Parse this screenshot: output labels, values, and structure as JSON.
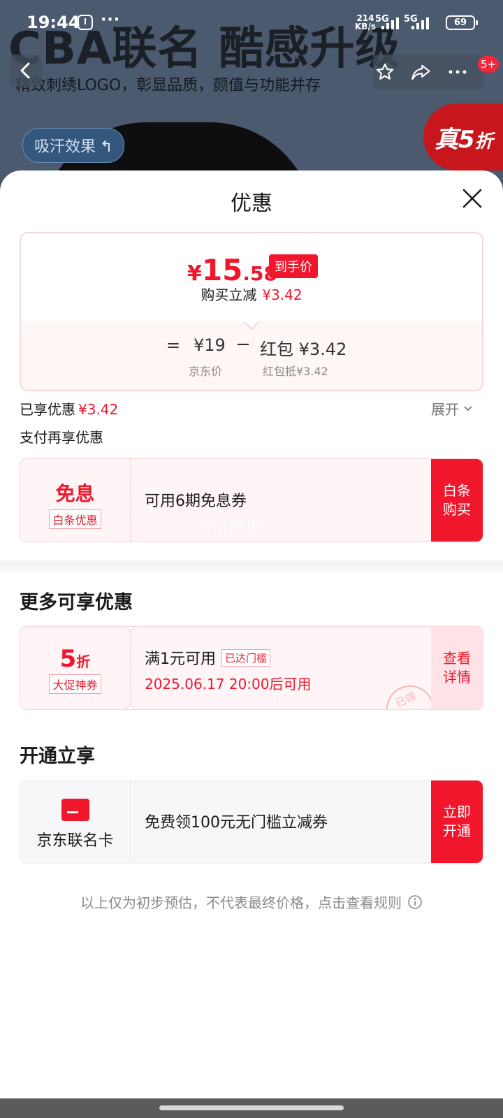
{
  "status_bar": {
    "time": "19:44",
    "dots": "···",
    "speed_value": "214",
    "speed_unit": "KB/s",
    "net1": "5G",
    "net2": "5G",
    "battery": "69"
  },
  "background": {
    "headline": "CBA联名 酷感升级",
    "subline": "精致刺绣LOGO，彰显品质，颜值与功能并存",
    "pill": "吸汗效果",
    "badge_prefix": "真",
    "badge_number": "5",
    "badge_suffix": "折",
    "nav_badge": "5+"
  },
  "sheet": {
    "title": "优惠",
    "price": {
      "currency": "¥",
      "integer": "15",
      "decimal": ".58",
      "tag": "到手价",
      "reduce_label": "购买立减",
      "reduce_amount": "¥3.42",
      "eq": "=",
      "jd_price": "¥19",
      "minus": "−",
      "hongbao": "红包 ¥3.42",
      "jd_price_caption": "京东价",
      "hongbao_caption": "红包抵¥3.42"
    },
    "enjoyed_label": "已享优惠",
    "enjoyed_amount": "¥3.42",
    "expand_label": "展开",
    "pay_more_label": "支付再享优惠",
    "baitiao_coupon": {
      "big": "免息",
      "tag": "白条优惠",
      "text": "可用6期免息券",
      "watermark": "好价推推",
      "action_line1": "白条",
      "action_line2": "购买"
    },
    "more_title": "更多可享优惠",
    "promo_coupon": {
      "discount_number": "5",
      "discount_unit": "折",
      "tag": "大促神券",
      "condition": "满1元可用",
      "reached": "已达门槛",
      "date": "2025.06.17 20:00后可用",
      "stamp": "已领",
      "action_line1": "查看",
      "action_line2": "详情"
    },
    "open_title": "开通立享",
    "card_coupon": {
      "label": "京东联名卡",
      "text": "免费领100元无门槛立减券",
      "action_line1": "立即",
      "action_line2": "开通"
    },
    "disclaimer": "以上仅为初步预估，不代表最终价格，点击查看规则"
  },
  "colors": {
    "accent_red": "#f0172c",
    "coupon_bg": "#fff5f6",
    "muted_text": "#8a8a8a"
  },
  "icons": [
    "app-icon",
    "back-icon",
    "star-icon",
    "share-icon",
    "more-icon",
    "close-icon",
    "chevron-down-icon",
    "card-icon",
    "info-icon"
  ]
}
